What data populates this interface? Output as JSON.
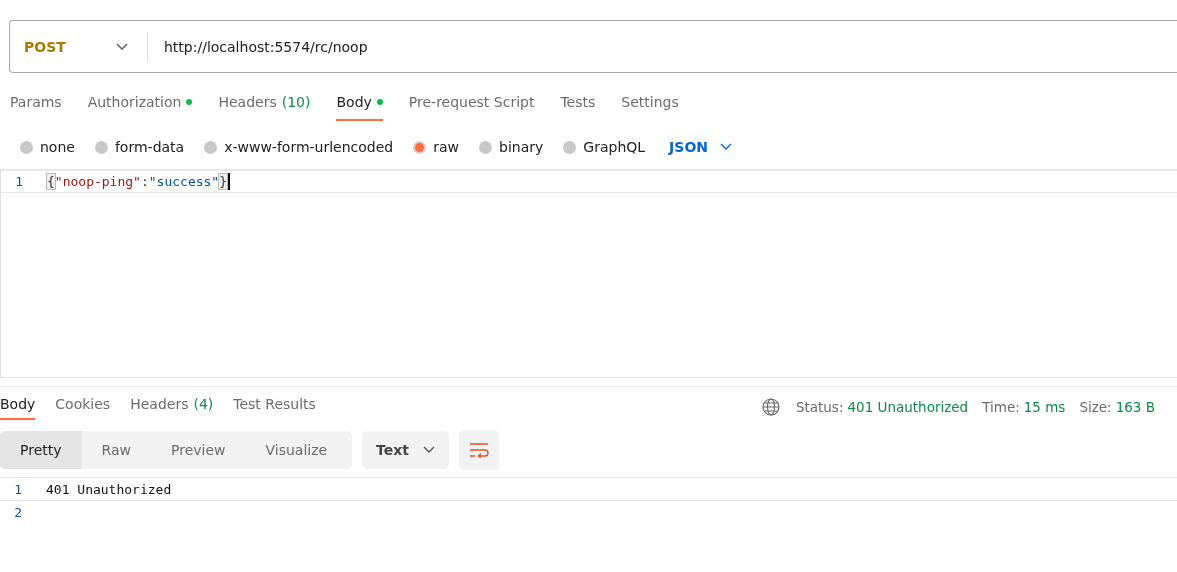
{
  "request": {
    "method": "POST",
    "url": "http://localhost:5574/rc/noop",
    "tabs": [
      {
        "label": "Params",
        "selected": false,
        "dot": false
      },
      {
        "label": "Authorization",
        "selected": false,
        "dot": true
      },
      {
        "label": "Headers",
        "count": "(10)",
        "selected": false,
        "dot": false
      },
      {
        "label": "Body",
        "selected": true,
        "dot": true
      },
      {
        "label": "Pre-request Script",
        "selected": false,
        "dot": false
      },
      {
        "label": "Tests",
        "selected": false,
        "dot": false
      },
      {
        "label": "Settings",
        "selected": false,
        "dot": false
      }
    ],
    "body_types": [
      {
        "label": "none",
        "selected": false
      },
      {
        "label": "form-data",
        "selected": false
      },
      {
        "label": "x-www-form-urlencoded",
        "selected": false
      },
      {
        "label": "raw",
        "selected": true
      },
      {
        "label": "binary",
        "selected": false
      },
      {
        "label": "GraphQL",
        "selected": false
      }
    ],
    "format": "JSON",
    "editor_lines": [
      {
        "number": "1",
        "tokens": [
          {
            "kind": "brace",
            "text": "{"
          },
          {
            "kind": "key",
            "text": "\"noop-ping\""
          },
          {
            "kind": "punct",
            "text": ":"
          },
          {
            "kind": "string",
            "text": "\"success\""
          },
          {
            "kind": "brace",
            "text": "}"
          }
        ]
      }
    ]
  },
  "response": {
    "tabs": [
      {
        "label": "Body",
        "selected": true
      },
      {
        "label": "Cookies",
        "selected": false
      },
      {
        "label": "Headers",
        "count": "(4)",
        "selected": false
      },
      {
        "label": "Test Results",
        "selected": false
      }
    ],
    "stats": [
      {
        "label": "Status:",
        "value": "401 Unauthorized"
      },
      {
        "label": "Time:",
        "value": "15 ms"
      },
      {
        "label": "Size:",
        "value": "163 B"
      }
    ],
    "view_modes": [
      {
        "label": "Pretty",
        "selected": true
      },
      {
        "label": "Raw",
        "selected": false
      },
      {
        "label": "Preview",
        "selected": false
      },
      {
        "label": "Visualize",
        "selected": false
      }
    ],
    "format": "Text",
    "lines": [
      {
        "number": "1",
        "text": "401 Unauthorized"
      },
      {
        "number": "2"
      }
    ]
  }
}
